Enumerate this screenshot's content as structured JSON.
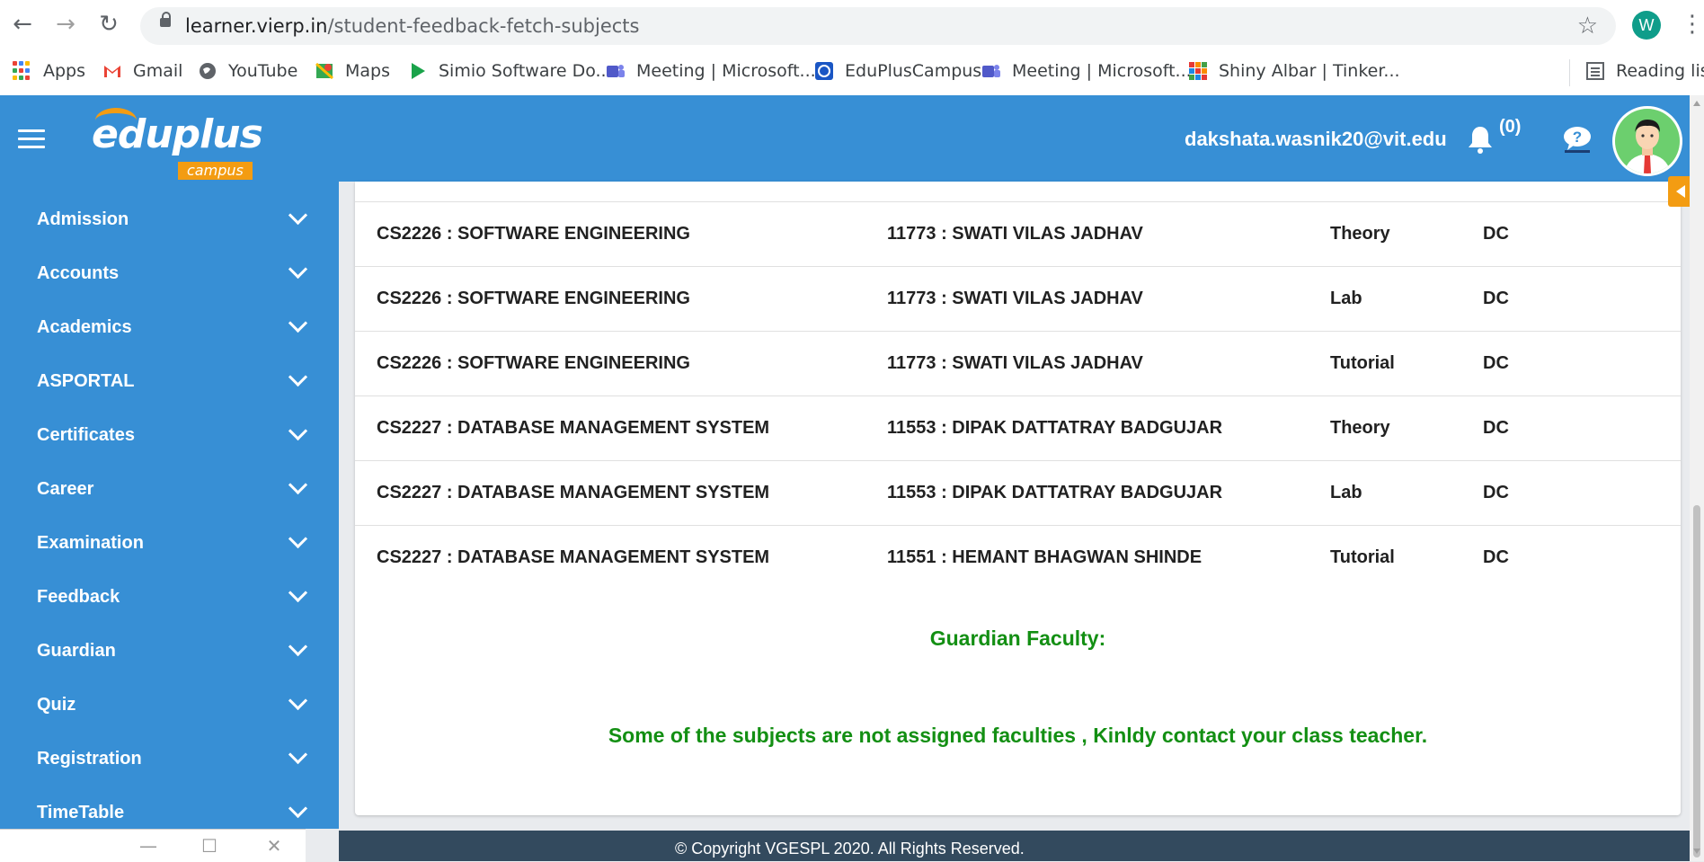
{
  "browser": {
    "url_host": "learner.vierp.in",
    "url_path": "/student-feedback-fetch-subjects",
    "profile_initial": "W",
    "bookmarks": [
      {
        "label": "Apps"
      },
      {
        "label": "Gmail"
      },
      {
        "label": "YouTube"
      },
      {
        "label": "Maps"
      },
      {
        "label": "Simio Software Do..."
      },
      {
        "label": "Meeting | Microsoft..."
      },
      {
        "label": "EduPlusCampus"
      },
      {
        "label": "Meeting | Microsoft..."
      },
      {
        "label": "Shiny Albar | Tinker..."
      }
    ],
    "reading_list": "Reading list"
  },
  "header": {
    "logo_text": "eduplus",
    "logo_sub": "campus",
    "user_email": "dakshata.wasnik20@vit.edu",
    "notification_count": "(0)",
    "colors": {
      "primary": "#378fd5",
      "accent": "#f39c12"
    }
  },
  "sidebar": {
    "items": [
      {
        "label": "Admission"
      },
      {
        "label": "Accounts"
      },
      {
        "label": "Academics"
      },
      {
        "label": "ASPORTAL"
      },
      {
        "label": "Certificates"
      },
      {
        "label": "Career"
      },
      {
        "label": "Examination"
      },
      {
        "label": "Feedback"
      },
      {
        "label": "Guardian"
      },
      {
        "label": "Quiz"
      },
      {
        "label": "Registration"
      },
      {
        "label": "TimeTable"
      }
    ]
  },
  "subjects": [
    {
      "subject": "CS2226 : SOFTWARE ENGINEERING",
      "faculty": "11773 : SWATI VILAS JADHAV",
      "type": "Theory",
      "category": "DC"
    },
    {
      "subject": "CS2226 : SOFTWARE ENGINEERING",
      "faculty": "11773 : SWATI VILAS JADHAV",
      "type": "Lab",
      "category": "DC"
    },
    {
      "subject": "CS2226 : SOFTWARE ENGINEERING",
      "faculty": "11773 : SWATI VILAS JADHAV",
      "type": "Tutorial",
      "category": "DC"
    },
    {
      "subject": "CS2227 : DATABASE MANAGEMENT SYSTEM",
      "faculty": "11553 : DIPAK DATTATRAY BADGUJAR",
      "type": "Theory",
      "category": "DC"
    },
    {
      "subject": "CS2227 : DATABASE MANAGEMENT SYSTEM",
      "faculty": "11553 : DIPAK DATTATRAY BADGUJAR",
      "type": "Lab",
      "category": "DC"
    },
    {
      "subject": "CS2227 : DATABASE MANAGEMENT SYSTEM",
      "faculty": "11551 : HEMANT BHAGWAN SHINDE",
      "type": "Tutorial",
      "category": "DC"
    }
  ],
  "guardian": {
    "heading": "Guardian Faculty:",
    "message": "Some of the subjects are not assigned faculties , Kinldy contact your class teacher.",
    "color": "#138f13"
  },
  "footer": {
    "text": "© Copyright VGESPL 2020. All Rights Reserved."
  }
}
